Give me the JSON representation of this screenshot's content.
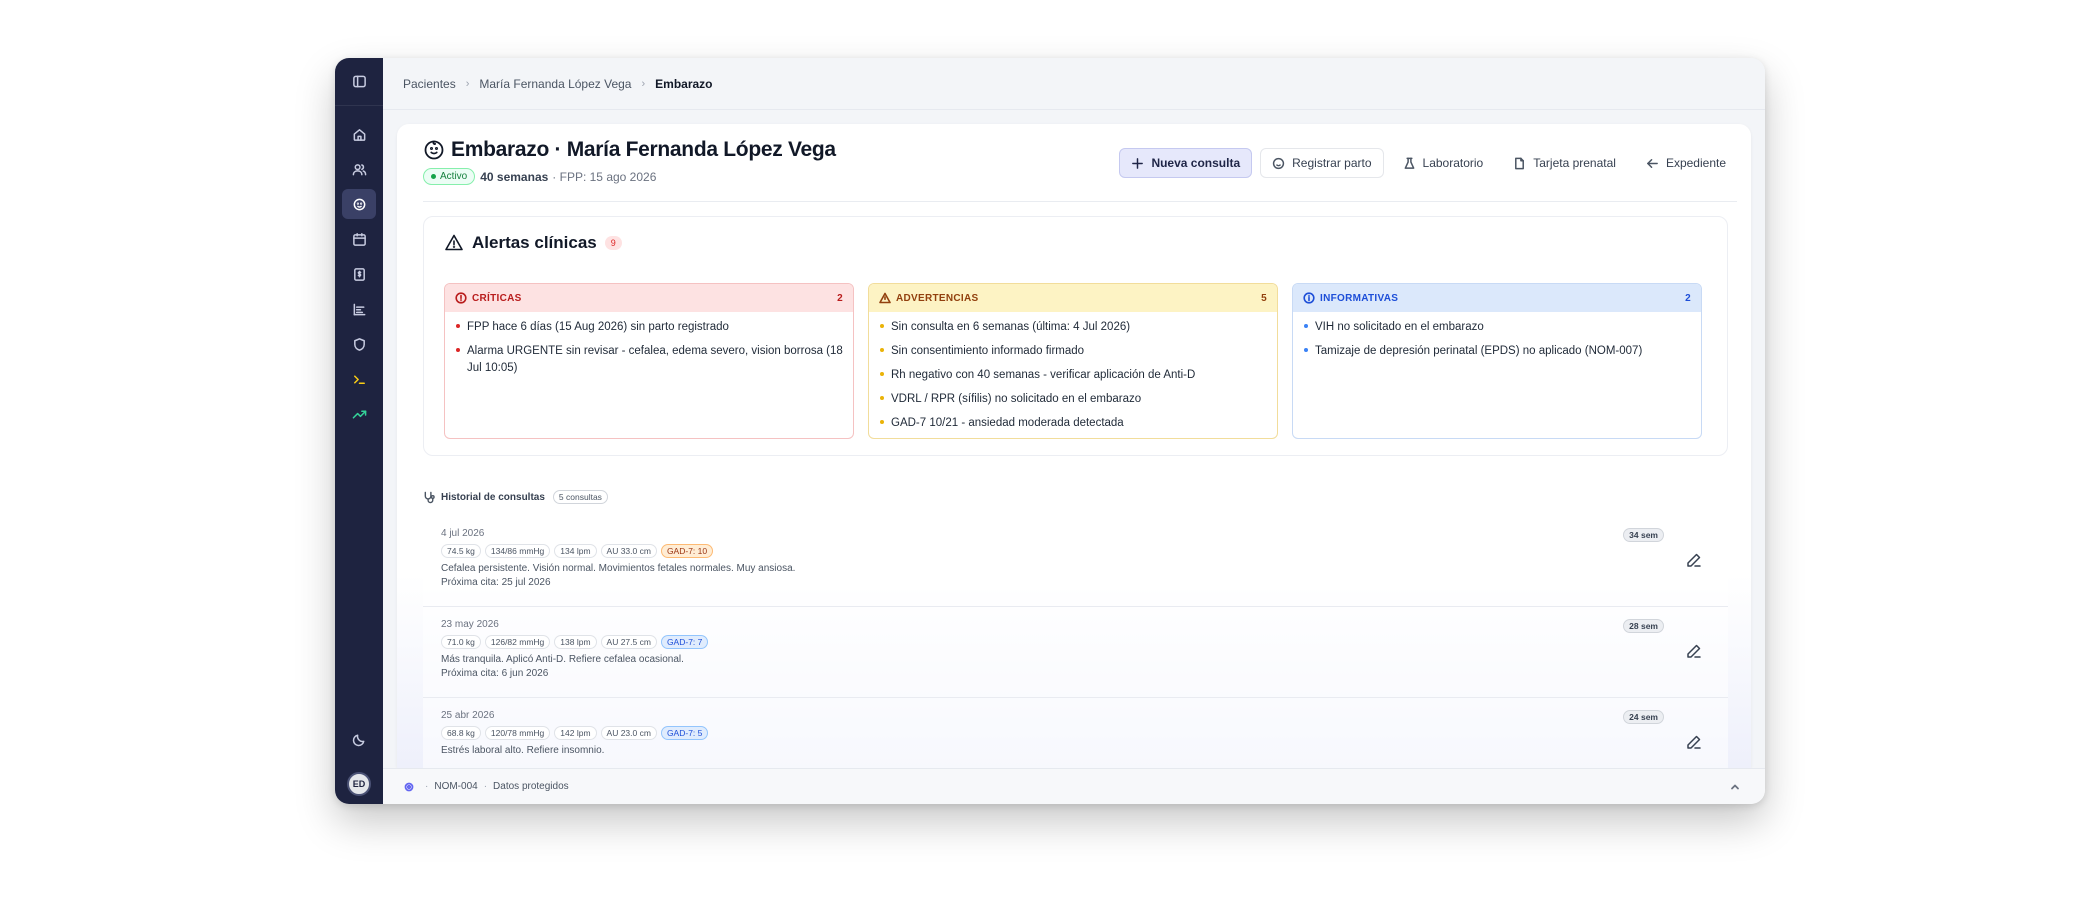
{
  "breadcrumb": {
    "items": [
      "Pacientes",
      "María Fernanda López Vega"
    ],
    "current": "Embarazo"
  },
  "header": {
    "title": "Embarazo · María Fernanda López Vega",
    "status": "Activo",
    "weeks": "40 semanas",
    "fpp": "· FPP: 15 ago 2026"
  },
  "actions": {
    "new": "Nueva consulta",
    "birth": "Registrar parto",
    "lab": "Laboratorio",
    "card": "Tarjeta prenatal",
    "record": "Expediente"
  },
  "alerts": {
    "title": "Alertas clínicas",
    "count": "9",
    "critical": {
      "label": "CRÍTICAS",
      "count": "2",
      "items": [
        "FPP hace 6 días (15 Aug 2026) sin parto registrado",
        "Alarma URGENTE sin revisar - cefalea, edema severo, vision borrosa (18 Jul 10:05)"
      ]
    },
    "warnings": {
      "label": "ADVERTENCIAS",
      "count": "5",
      "items": [
        "Sin consulta en 6 semanas (última: 4 Jul 2026)",
        "Sin consentimiento informado firmado",
        "Rh negativo con 40 semanas - verificar aplicación de Anti-D",
        "VDRL / RPR (sífilis) no solicitado en el embarazo",
        "GAD-7 10/21 - ansiedad moderada detectada"
      ]
    },
    "info": {
      "label": "INFORMATIVAS",
      "count": "2",
      "items": [
        "VIH no solicitado en el embarazo",
        "Tamizaje de depresión perinatal (EPDS) no aplicado (NOM-007)"
      ]
    }
  },
  "history": {
    "title": "Historial de consultas",
    "count": "5 consultas",
    "rows": [
      {
        "date": "4 jul 2026",
        "weight": "74.5 kg",
        "bp": "134/86 mmHg",
        "hr": "134 lpm",
        "au": "AU 33.0 cm",
        "gad": "GAD-7: 10",
        "note": "Cefalea persistente. Visión normal. Movimientos fetales normales. Muy ansiosa.",
        "next": "Próxima cita: 25 jul 2026",
        "week": "34 sem"
      },
      {
        "date": "23 may 2026",
        "weight": "71.0 kg",
        "bp": "126/82 mmHg",
        "hr": "138 lpm",
        "au": "AU 27.5 cm",
        "gad": "GAD-7: 7",
        "note": "Más tranquila. Aplicó Anti-D. Refiere cefalea ocasional.",
        "next": "Próxima cita: 6 jun 2026",
        "week": "28 sem"
      },
      {
        "date": "25 abr 2026",
        "weight": "68.8 kg",
        "bp": "120/78 mmHg",
        "hr": "142 lpm",
        "au": "AU 23.0 cm",
        "gad": "GAD-7: 5",
        "note": "Estrés laboral alto. Refiere insomnio.",
        "next": "",
        "week": "24 sem"
      }
    ]
  },
  "footer": {
    "std": "NOM-004",
    "privacy": "Datos protegidos"
  },
  "user": {
    "initials": "ED"
  }
}
